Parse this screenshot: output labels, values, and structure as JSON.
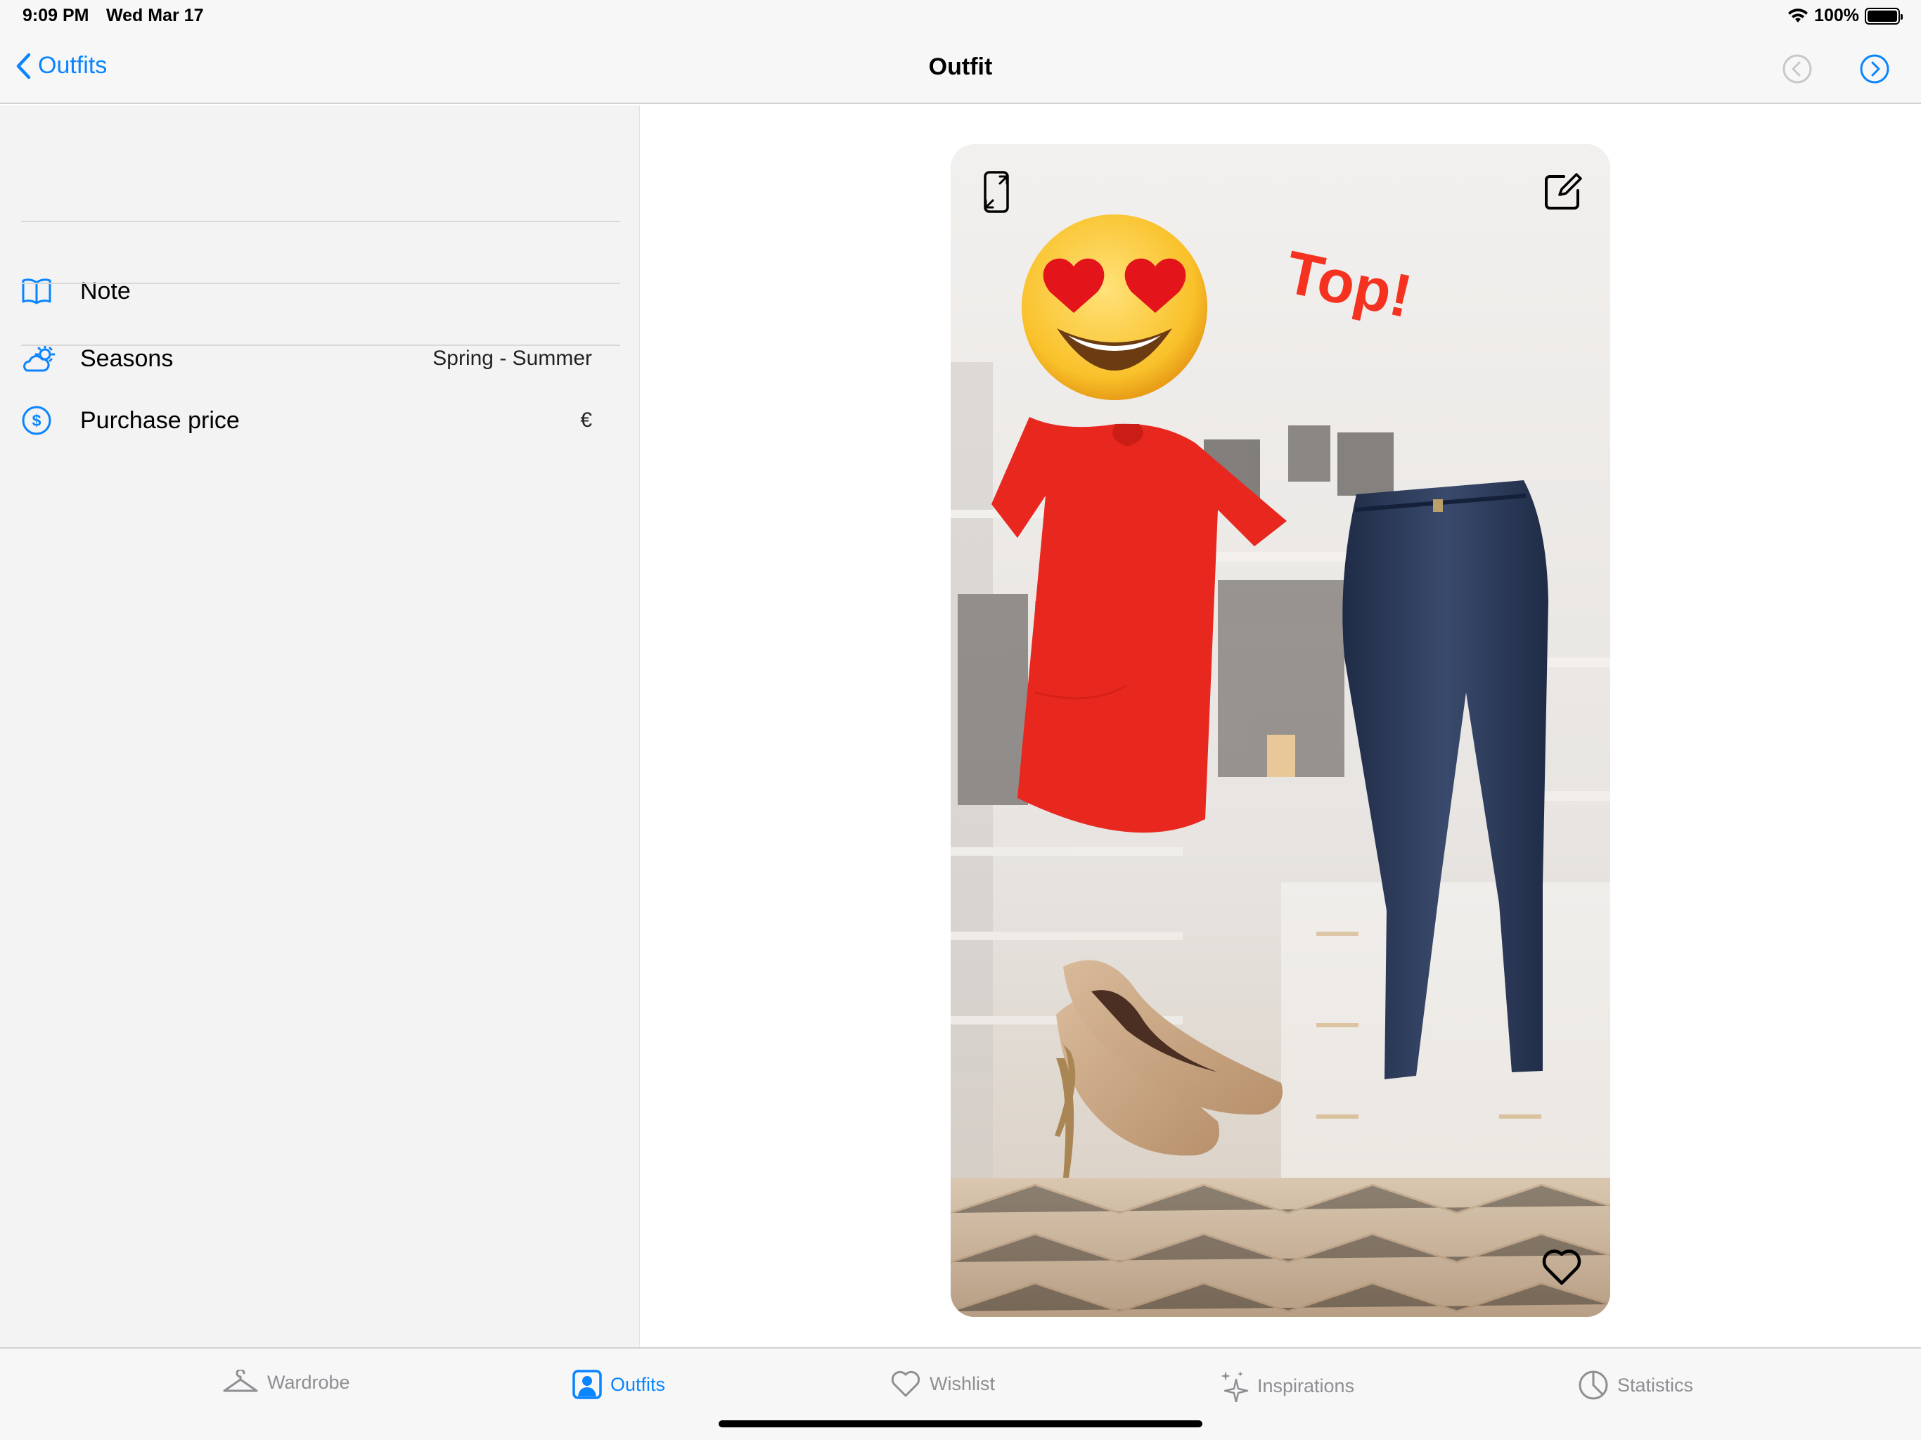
{
  "status": {
    "time": "9:09 PM",
    "date": "Wed Mar 17",
    "battery": "100%"
  },
  "nav": {
    "back_label": "Outfits",
    "title": "Outfit"
  },
  "details": {
    "note_label": "Note",
    "seasons_label": "Seasons",
    "seasons_value": "Spring - Summer",
    "price_label": "Purchase price",
    "price_value": "€"
  },
  "canvas": {
    "sticker_text": "Top!"
  },
  "tabs": [
    {
      "label": "Wardrobe",
      "icon": "hanger-icon"
    },
    {
      "label": "Outfits",
      "icon": "person-square-icon"
    },
    {
      "label": "Wishlist",
      "icon": "heart-icon"
    },
    {
      "label": "Inspirations",
      "icon": "sparkles-icon"
    },
    {
      "label": "Statistics",
      "icon": "pie-chart-icon"
    }
  ],
  "colors": {
    "accent": "#0a84ff",
    "inactive": "#8e8e93",
    "shirt": "#e8281f",
    "jeans": "#2b3a5a"
  }
}
